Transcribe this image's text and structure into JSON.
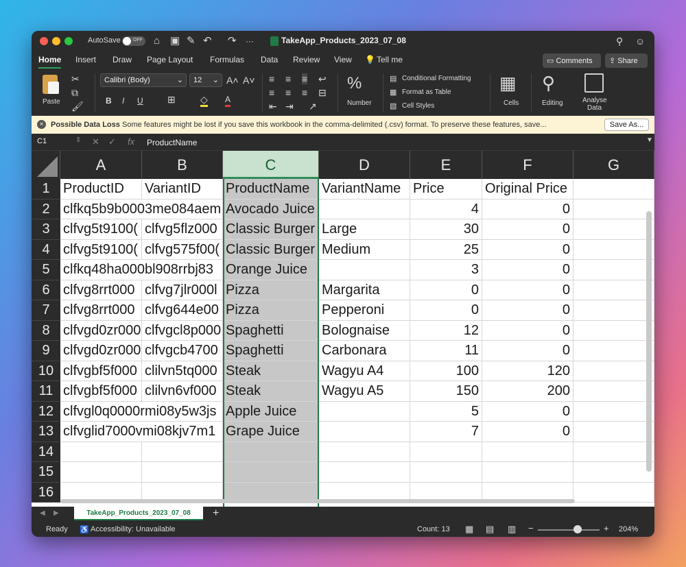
{
  "titlebar": {
    "autosave_label": "AutoSave",
    "autosave_state": "OFF",
    "doc_title": "TakeApp_Products_2023_07_08",
    "more": "···"
  },
  "tabs": [
    "Home",
    "Insert",
    "Draw",
    "Page Layout",
    "Formulas",
    "Data",
    "Review",
    "View",
    "Tell me"
  ],
  "buttons": {
    "comments": "Comments",
    "share": "Share"
  },
  "ribbon": {
    "paste": "Paste",
    "font_name": "Calibri (Body)",
    "font_size": "12",
    "number": "Number",
    "conditional_formatting": "Conditional Formatting",
    "format_as_table": "Format as Table",
    "cell_styles": "Cell Styles",
    "cells": "Cells",
    "editing": "Editing",
    "analyse_data_1": "Analyse",
    "analyse_data_2": "Data",
    "percent_symbol": "%"
  },
  "infobar": {
    "title": "Possible Data Loss",
    "message": "Some features might be lost if you save this workbook in the comma-delimited (.csv) format. To preserve these features, save...",
    "button": "Save As..."
  },
  "formula_bar": {
    "cell_ref": "C1",
    "fx": "fx",
    "value": "ProductName"
  },
  "columns": [
    "A",
    "B",
    "C",
    "D",
    "E",
    "F",
    "G"
  ],
  "selected_column": "C",
  "rows": [
    {
      "n": "1",
      "a": "ProductID",
      "b": "VariantID",
      "c": "ProductName",
      "d": "VariantName",
      "e": "Price",
      "f": "Original Price"
    },
    {
      "n": "2",
      "a": "clfkq5b9b0003me084aem",
      "b": "",
      "c": "Avocado Juice",
      "d": "",
      "e": "4",
      "f": "0"
    },
    {
      "n": "3",
      "a": "clfvg5t9100(",
      "b": "clfvg5flz000",
      "c": "Classic Burger",
      "d": "Large",
      "e": "30",
      "f": "0"
    },
    {
      "n": "4",
      "a": "clfvg5t9100(",
      "b": "clfvg575f00(",
      "c": "Classic Burger",
      "d": "Medium",
      "e": "25",
      "f": "0"
    },
    {
      "n": "5",
      "a": "clfkq48ha000bl908rrbj83",
      "b": "",
      "c": "Orange Juice",
      "d": "",
      "e": "3",
      "f": "0"
    },
    {
      "n": "6",
      "a": "clfvg8rrt000",
      "b": "clfvg7jlr000l",
      "c": "Pizza",
      "d": "Margarita",
      "e": "0",
      "f": "0"
    },
    {
      "n": "7",
      "a": "clfvg8rrt000",
      "b": "clfvg644e00",
      "c": "Pizza",
      "d": "Pepperoni",
      "e": "0",
      "f": "0"
    },
    {
      "n": "8",
      "a": "clfvgd0zr000",
      "b": "clfvgcl8p000",
      "c": "Spaghetti",
      "d": "Bolognaise",
      "e": "12",
      "f": "0"
    },
    {
      "n": "9",
      "a": "clfvgd0zr000",
      "b": "clfvgcb4700",
      "c": "Spaghetti",
      "d": "Carbonara",
      "e": "11",
      "f": "0"
    },
    {
      "n": "10",
      "a": "clfvgbf5f000",
      "b": "clilvn5tq000",
      "c": "Steak",
      "d": "Wagyu A4",
      "e": "100",
      "f": "120"
    },
    {
      "n": "11",
      "a": "clfvgbf5f000",
      "b": "clilvn6vf000",
      "c": "Steak",
      "d": "Wagyu A5",
      "e": "150",
      "f": "200"
    },
    {
      "n": "12",
      "a": "clfvgl0q0000rmi08y5w3js",
      "b": "",
      "c": "Apple Juice",
      "d": "",
      "e": "5",
      "f": "0"
    },
    {
      "n": "13",
      "a": "clfvglid7000vmi08kjv7m1",
      "b": "",
      "c": "Grape Juice",
      "d": "",
      "e": "7",
      "f": "0"
    },
    {
      "n": "14",
      "a": "",
      "b": "",
      "c": "",
      "d": "",
      "e": "",
      "f": ""
    },
    {
      "n": "15",
      "a": "",
      "b": "",
      "c": "",
      "d": "",
      "e": "",
      "f": ""
    },
    {
      "n": "16",
      "a": "",
      "b": "",
      "c": "",
      "d": "",
      "e": "",
      "f": ""
    }
  ],
  "sheet_tab": "TakeApp_Products_2023_07_08",
  "add_sheet": "+",
  "status": {
    "ready": "Ready",
    "accessibility": "Accessibility: Unavailable",
    "count": "Count: 13",
    "zoom_minus": "−",
    "zoom_plus": "+",
    "zoom": "204%"
  }
}
